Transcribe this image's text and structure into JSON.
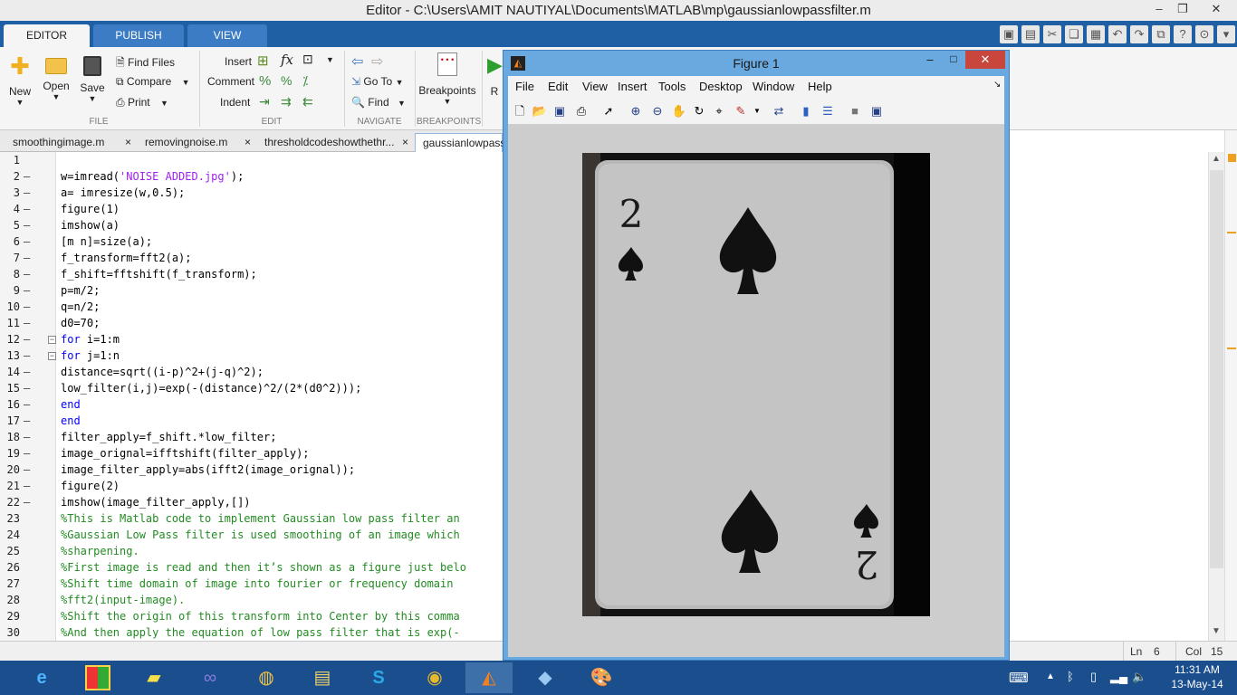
{
  "window": {
    "title": "Editor - C:\\Users\\AMIT NAUTIYAL\\Documents\\MATLAB\\mp\\gaussianlowpassfilter.m"
  },
  "tabs": [
    {
      "label": "EDITOR"
    },
    {
      "label": "PUBLISH"
    },
    {
      "label": "VIEW"
    }
  ],
  "ribbon": {
    "file": {
      "new": "New",
      "open": "Open",
      "save": "Save",
      "find_files": "Find Files",
      "compare": "Compare",
      "print": "Print",
      "section": "FILE"
    },
    "edit": {
      "insert": "Insert",
      "comment": "Comment",
      "indent": "Indent",
      "section": "EDIT"
    },
    "navigate": {
      "goto": "Go To",
      "find": "Find",
      "section": "NAVIGATE"
    },
    "breakpoints": {
      "label": "Breakpoints",
      "section": "BREAKPOINTS"
    },
    "run": {
      "label": "R"
    }
  },
  "doc_tabs": [
    {
      "label": "smoothingimage.m",
      "close": "×"
    },
    {
      "label": "removingnoise.m",
      "close": "×"
    },
    {
      "label": "thresholdcodeshowthethr...",
      "close": "×"
    },
    {
      "label": "gaussianlowpass"
    }
  ],
  "code_lines": [
    {
      "n": "1",
      "dash": "",
      "text": ""
    },
    {
      "n": "2",
      "dash": "–",
      "text": "w=imread('NOISE ADDED.jpg');"
    },
    {
      "n": "3",
      "dash": "–",
      "text": "a= imresize(w,0.5);"
    },
    {
      "n": "4",
      "dash": "–",
      "text": "figure(1)"
    },
    {
      "n": "5",
      "dash": "–",
      "text": "imshow(a)"
    },
    {
      "n": "6",
      "dash": "–",
      "text": "[m n]=size(a);"
    },
    {
      "n": "7",
      "dash": "–",
      "text": "f_transform=fft2(a);"
    },
    {
      "n": "8",
      "dash": "–",
      "text": "f_shift=fftshift(f_transform);"
    },
    {
      "n": "9",
      "dash": "–",
      "text": "p=m/2;"
    },
    {
      "n": "10",
      "dash": "–",
      "text": "q=n/2;"
    },
    {
      "n": "11",
      "dash": "–",
      "text": "d0=70;"
    },
    {
      "n": "12",
      "dash": "–",
      "text": "for i=1:m"
    },
    {
      "n": "13",
      "dash": "–",
      "text": "for j=1:n"
    },
    {
      "n": "14",
      "dash": "–",
      "text": "distance=sqrt((i-p)^2+(j-q)^2);"
    },
    {
      "n": "15",
      "dash": "–",
      "text": "low_filter(i,j)=exp(-(distance)^2/(2*(d0^2)));"
    },
    {
      "n": "16",
      "dash": "–",
      "text": "end"
    },
    {
      "n": "17",
      "dash": "–",
      "text": "end"
    },
    {
      "n": "18",
      "dash": "–",
      "text": "filter_apply=f_shift.*low_filter;"
    },
    {
      "n": "19",
      "dash": "–",
      "text": "image_orignal=ifftshift(filter_apply);"
    },
    {
      "n": "20",
      "dash": "–",
      "text": "image_filter_apply=abs(ifft2(image_orignal));"
    },
    {
      "n": "21",
      "dash": "–",
      "text": "figure(2)"
    },
    {
      "n": "22",
      "dash": "–",
      "text": "imshow(image_filter_apply,[])"
    },
    {
      "n": "23",
      "dash": "",
      "text": "%This is Matlab code to implement Gaussian low pass filter an"
    },
    {
      "n": "24",
      "dash": "",
      "text": "%Gaussian Low Pass filter is used smoothing of an image which"
    },
    {
      "n": "25",
      "dash": "",
      "text": "%sharpening."
    },
    {
      "n": "26",
      "dash": "",
      "text": "%First image is read and then it’s shown as a figure just belo"
    },
    {
      "n": "27",
      "dash": "",
      "text": "%Shift time domain of image into fourier or frequency domain"
    },
    {
      "n": "28",
      "dash": "",
      "text": "%fft2(input-image)."
    },
    {
      "n": "29",
      "dash": "",
      "text": "%Shift the origin of this transform into Center by this comma"
    },
    {
      "n": "30",
      "dash": "",
      "text": "%And then apply the equation of low pass filter that is exp(-"
    }
  ],
  "status": {
    "ln_label": "Ln",
    "ln": "6",
    "col_label": "Col",
    "col": "15"
  },
  "figure": {
    "title": "Figure 1",
    "menu": [
      "File",
      "Edit",
      "View",
      "Insert",
      "Tools",
      "Desktop",
      "Window",
      "Help"
    ],
    "card": {
      "rank": "2"
    }
  },
  "clock": {
    "time": "11:31 AM",
    "date": "13-May-14"
  },
  "colors": {
    "ribbon_tab_bar": "#1f5fa3",
    "keyword": "#0000ff",
    "string": "#a020f0",
    "comment": "#228b22",
    "figure_frame": "#6aa8e0",
    "taskbar": "#1a4e8c"
  }
}
